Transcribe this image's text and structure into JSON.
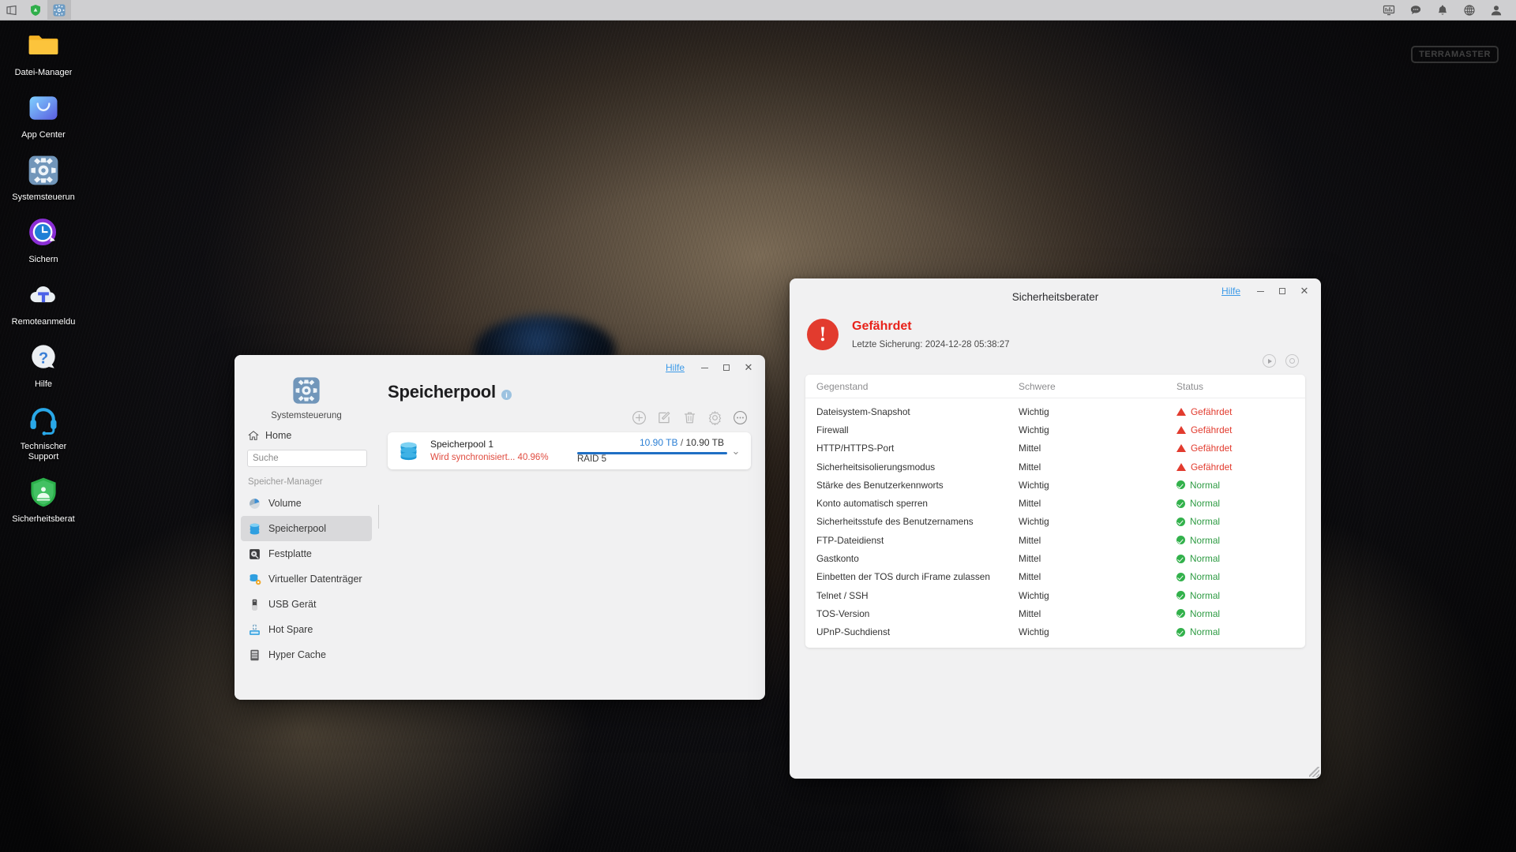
{
  "taskbar": {
    "left_buttons": [
      {
        "name": "show-desktop-icon",
        "label": "Desktop anzeigen",
        "active": false
      },
      {
        "name": "security-advisor-taskbar-icon",
        "label": "Sicherheitsberater",
        "active": false
      },
      {
        "name": "control-panel-taskbar-icon",
        "label": "Systemsteuerung",
        "active": true
      }
    ],
    "right_buttons": [
      {
        "name": "resource-monitor-icon",
        "label": "Ressourcenmonitor"
      },
      {
        "name": "chat-icon",
        "label": "Chat"
      },
      {
        "name": "notification-bell-icon",
        "label": "Benachrichtigungen"
      },
      {
        "name": "language-globe-icon",
        "label": "Sprache"
      },
      {
        "name": "user-account-icon",
        "label": "Benutzerkonto"
      }
    ]
  },
  "brand": {
    "logo_text": "TERRAMASTER"
  },
  "desktop_icons": [
    {
      "name": "file-manager",
      "label": "Datei-Manager",
      "icon": "folder-icon"
    },
    {
      "name": "app-center",
      "label": "App Center",
      "icon": "shopping-bag-icon"
    },
    {
      "name": "control-panel",
      "label": "Systemsteuerun",
      "icon": "gear-icon"
    },
    {
      "name": "backup",
      "label": "Sichern",
      "icon": "clock-icon"
    },
    {
      "name": "remote-login",
      "label": "Remoteanmeldu",
      "icon": "cloud-t-icon"
    },
    {
      "name": "help",
      "label": "Hilfe",
      "icon": "question-mark-icon"
    },
    {
      "name": "tech-support",
      "label": "Technischer\nSupport",
      "icon": "headset-icon"
    },
    {
      "name": "security-advisor",
      "label": "Sicherheitsberat",
      "icon": "green-shield-icon"
    }
  ],
  "storage_window": {
    "titlebar": {
      "help_label": "Hilfe",
      "minimize_label": "Minimieren",
      "maximize_label": "Maximieren",
      "close_label": "Schließen"
    },
    "app_name": "Systemsteuerung",
    "home_label": "Home",
    "search": {
      "value": "",
      "placeholder": "Suche"
    },
    "group_label": "Speicher-Manager",
    "sidebar_items": [
      {
        "label": "Volume",
        "icon": "volume-pie-icon",
        "selected": false
      },
      {
        "label": "Speicherpool",
        "icon": "storage-pool-icon",
        "selected": true
      },
      {
        "label": "Festplatte",
        "icon": "hard-disk-icon",
        "selected": false
      },
      {
        "label": "Virtueller Datenträger",
        "icon": "virtual-disk-icon",
        "selected": false
      },
      {
        "label": "USB Gerät",
        "icon": "usb-device-icon",
        "selected": false
      },
      {
        "label": "Hot Spare",
        "icon": "hot-spare-icon",
        "selected": false
      },
      {
        "label": "Hyper Cache",
        "icon": "hyper-cache-icon",
        "selected": false
      }
    ],
    "page_title": "Speicherpool",
    "info_badge": "i",
    "toolbar": [
      {
        "name": "create-pool-button",
        "label": "Erstellen",
        "icon": "plus-circle-icon",
        "enabled": false
      },
      {
        "name": "edit-pool-button",
        "label": "Bearbeiten",
        "icon": "edit-square-icon",
        "enabled": false
      },
      {
        "name": "delete-pool-button",
        "label": "Löschen",
        "icon": "trash-icon",
        "enabled": false
      },
      {
        "name": "pool-settings-button",
        "label": "Einstellungen",
        "icon": "gear-icon",
        "enabled": false
      },
      {
        "name": "pool-more-button",
        "label": "Mehr",
        "icon": "ellipsis-circle-icon",
        "enabled": true
      }
    ],
    "pool": {
      "name": "Speicherpool 1",
      "status": "Wird synchronisiert... 40.96%",
      "used": "10.90 TB",
      "separator": "/",
      "total": "10.90 TB",
      "raid": "RAID 5",
      "fill_percent": 100,
      "expand_label": "Erweitern"
    }
  },
  "security_window": {
    "titlebar": {
      "help_label": "Hilfe",
      "minimize_label": "Minimieren",
      "maximize_label": "Maximieren",
      "close_label": "Schließen"
    },
    "title": "Sicherheitsberater",
    "status_badge": "!",
    "status_text": "Gefährdet",
    "last_scan": "Letzte Sicherung: 2024-12-28 05:38:27",
    "actions": [
      {
        "name": "run-scan-button",
        "label": "Scan starten",
        "icon": "play-circle-icon"
      },
      {
        "name": "scan-settings-button",
        "label": "Scan-Einstellungen",
        "icon": "record-circle-icon"
      }
    ],
    "columns": [
      "Gegenstand",
      "Schwere",
      "Status"
    ],
    "rows": [
      {
        "item": "Dateisystem-Snapshot",
        "severity": "Wichtig",
        "status": "Gefährdet",
        "state": "risk"
      },
      {
        "item": "Firewall",
        "severity": "Wichtig",
        "status": "Gefährdet",
        "state": "risk"
      },
      {
        "item": "HTTP/HTTPS-Port",
        "severity": "Mittel",
        "status": "Gefährdet",
        "state": "risk"
      },
      {
        "item": "Sicherheitsisolierungsmodus",
        "severity": "Mittel",
        "status": "Gefährdet",
        "state": "risk"
      },
      {
        "item": "Stärke des Benutzerkennworts",
        "severity": "Wichtig",
        "status": "Normal",
        "state": "ok"
      },
      {
        "item": "Konto automatisch sperren",
        "severity": "Mittel",
        "status": "Normal",
        "state": "ok"
      },
      {
        "item": "Sicherheitsstufe des Benutzernamens",
        "severity": "Wichtig",
        "status": "Normal",
        "state": "ok"
      },
      {
        "item": "FTP-Dateidienst",
        "severity": "Mittel",
        "status": "Normal",
        "state": "ok"
      },
      {
        "item": "Gastkonto",
        "severity": "Mittel",
        "status": "Normal",
        "state": "ok"
      },
      {
        "item": "Einbetten der TOS durch iFrame zulassen",
        "severity": "Mittel",
        "status": "Normal",
        "state": "ok"
      },
      {
        "item": "Telnet / SSH",
        "severity": "Wichtig",
        "status": "Normal",
        "state": "ok"
      },
      {
        "item": "TOS-Version",
        "severity": "Mittel",
        "status": "Normal",
        "state": "ok"
      },
      {
        "item": "UPnP-Suchdienst",
        "severity": "Wichtig",
        "status": "Normal",
        "state": "ok"
      }
    ]
  },
  "colors": {
    "risk_red": "#e23b2e",
    "ok_green": "#32b14b",
    "accent_blue": "#1f6fc4",
    "link_blue": "#3c9ae8",
    "taskbar": "#cfcfd1",
    "window_bg": "#f1f1f2"
  }
}
